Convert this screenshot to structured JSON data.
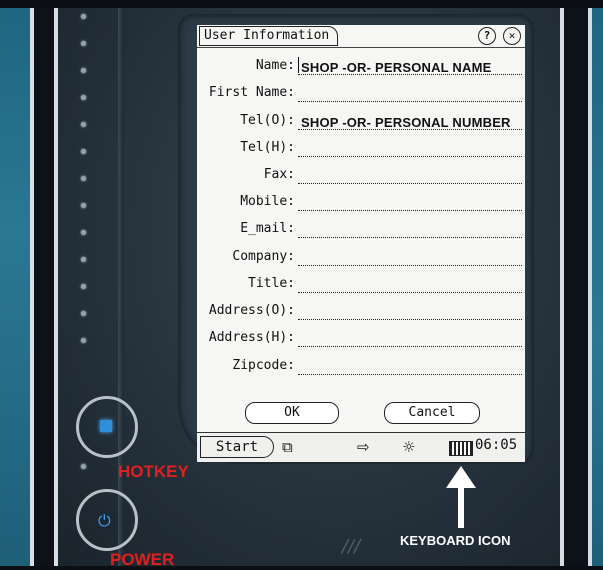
{
  "dialog": {
    "title": "User Information",
    "fields": [
      {
        "label": "Name:",
        "value": "SHOP -OR- PERSONAL NAME"
      },
      {
        "label": "First Name:",
        "value": ""
      },
      {
        "label": "Tel(O):",
        "value": "SHOP -OR- PERSONAL NUMBER"
      },
      {
        "label": "Tel(H):",
        "value": ""
      },
      {
        "label": "Fax:",
        "value": ""
      },
      {
        "label": "Mobile:",
        "value": ""
      },
      {
        "label": "E_mail:",
        "value": ""
      },
      {
        "label": "Company:",
        "value": ""
      },
      {
        "label": "Title:",
        "value": ""
      },
      {
        "label": "Address(O):",
        "value": ""
      },
      {
        "label": "Address(H):",
        "value": ""
      },
      {
        "label": "Zipcode:",
        "value": ""
      }
    ],
    "ok_label": "OK",
    "cancel_label": "Cancel",
    "help_glyph": "?",
    "close_glyph": "✕"
  },
  "taskbar": {
    "start_label": "Start",
    "tasks_glyph": "⧉",
    "arrow_glyph": "⇨",
    "brightness_glyph": "☼",
    "clock": "06:05"
  },
  "annotations": {
    "hotkey": "HOTKEY",
    "power": "POWER",
    "keyboard_icon": "KEYBOARD ICON"
  },
  "device": {
    "power_glyph": "⏻",
    "logo_text": "///"
  },
  "colors": {
    "annotation_red": "#e02020",
    "button_blue": "#2f8fd8",
    "panel_teal": "#1f6680"
  }
}
